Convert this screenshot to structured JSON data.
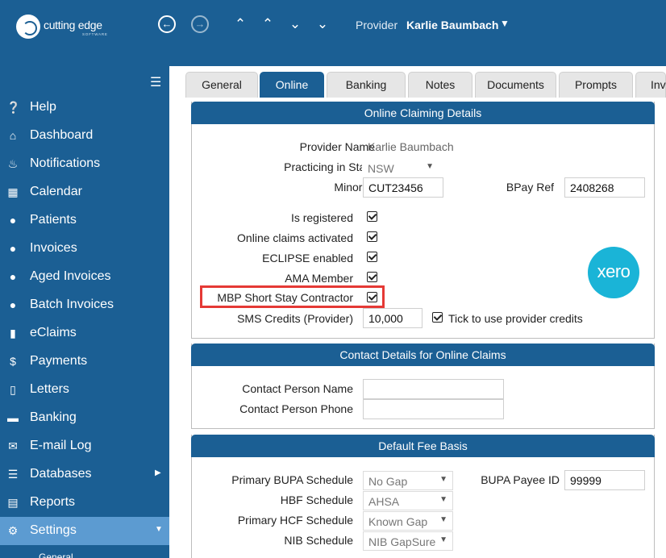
{
  "app": {
    "logo_text": "cutting edge",
    "logo_sub": "SOFTWARE"
  },
  "header": {
    "provider_label": "Provider",
    "provider_name": "Karlie Baumbach"
  },
  "sidebar": {
    "items": [
      {
        "label": "Help",
        "icon": "help-icon"
      },
      {
        "label": "Dashboard",
        "icon": "home-icon"
      },
      {
        "label": "Notifications",
        "icon": "bell-icon"
      },
      {
        "label": "Calendar",
        "icon": "calendar-icon"
      },
      {
        "label": "Patients",
        "icon": "users-icon"
      },
      {
        "label": "Invoices",
        "icon": "user-icon"
      },
      {
        "label": "Aged Invoices",
        "icon": "aged-user-icon"
      },
      {
        "label": "Batch Invoices",
        "icon": "group-icon"
      },
      {
        "label": "eClaims",
        "icon": "file-icon"
      },
      {
        "label": "Payments",
        "icon": "dollar-icon"
      },
      {
        "label": "Letters",
        "icon": "word-doc-icon"
      },
      {
        "label": "Banking",
        "icon": "money-icon"
      },
      {
        "label": "E-mail Log",
        "icon": "envelope-icon"
      },
      {
        "label": "Databases",
        "icon": "database-icon"
      },
      {
        "label": "Reports",
        "icon": "list-icon"
      },
      {
        "label": "Settings",
        "icon": "user-settings-icon"
      }
    ],
    "sub_item": "General"
  },
  "tabs": [
    "General",
    "Online",
    "Banking",
    "Notes",
    "Documents",
    "Prompts",
    "Inv"
  ],
  "online_claiming": {
    "title": "Online Claiming Details",
    "provider_name_label": "Provider Name",
    "provider_name": "Karlie Baumbach",
    "state_label": "Practicing in State",
    "state": "NSW",
    "minor_id_label": "Minor Id",
    "minor_id": "CUT23456",
    "bpay_label": "BPay Ref",
    "bpay": "2408268",
    "is_registered": "Is registered",
    "online_claims": "Online claims activated",
    "eclipse": "ECLIPSE enabled",
    "ama": "AMA Member",
    "mbp": "MBP Short Stay Contractor",
    "sms_label": "SMS Credits (Provider)",
    "sms": "10,000",
    "tick_label": "Tick to use provider credits",
    "xero": "xero"
  },
  "contact": {
    "title": "Contact Details for Online Claims",
    "person_name": "Contact Person Name",
    "person_phone": "Contact Person Phone"
  },
  "fee": {
    "title": "Default Fee Basis",
    "bupa_label": "Primary BUPA Schedule",
    "bupa": "No Gap",
    "bupa_payee_label": "BUPA Payee ID",
    "bupa_payee": "99999",
    "hbf_label": "HBF Schedule",
    "hbf": "AHSA",
    "hcf_label": "Primary HCF Schedule",
    "hcf": "Known Gap",
    "nib_label": "NIB Schedule",
    "nib": "NIB GapSure"
  },
  "colors": {
    "primary": "#1b5f94",
    "active_sidebar": "#5c9bd1",
    "highlight": "#e53935",
    "xero": "#1ab4d7"
  }
}
